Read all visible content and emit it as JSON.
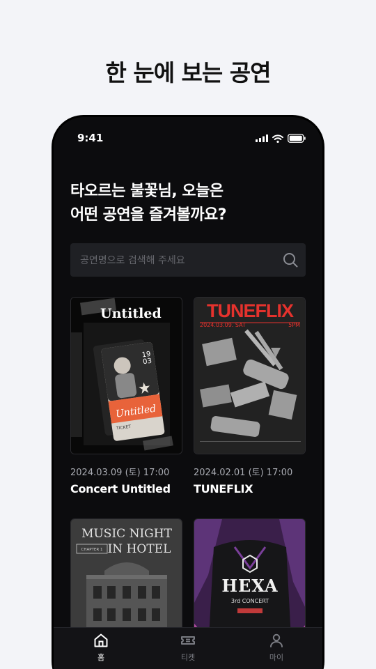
{
  "headline": "한 눈에 보는 공연",
  "status_bar": {
    "time": "9:41"
  },
  "greeting": {
    "line1": "타오르는 불꽃님, 오늘은",
    "line2": "어떤 공연을 즐겨볼까요?"
  },
  "search": {
    "placeholder": "공연명으로 검색해 주세요"
  },
  "cards": [
    {
      "date": "2024.03.09 (토) 17:00",
      "title": "Concert Untitled",
      "poster": {
        "heading": "Untitled",
        "ticket_number_top": "19",
        "ticket_number_mid": "03",
        "ticket_script": "Untitled",
        "ticket_label": "TICKET"
      }
    },
    {
      "date": "2024.02.01 (토) 17:00",
      "title": "TUNEFLIX",
      "poster": {
        "heading": "TUNEFLIX",
        "date_line": "2024.03.09. SAT",
        "time_line": "5PM",
        "accent": "#e5322d"
      }
    },
    {
      "poster": {
        "heading_line1": "MUSIC NIGHT",
        "heading_line2": "IN HOTEL",
        "badge": "CHAPTER 1"
      }
    },
    {
      "poster": {
        "heading": "HEXA",
        "subheading": "3rd CONCERT"
      }
    }
  ],
  "tabbar": [
    {
      "label": "홈",
      "icon": "home-icon",
      "active": true
    },
    {
      "label": "티켓",
      "icon": "ticket-icon",
      "active": false
    },
    {
      "label": "마이",
      "icon": "user-icon",
      "active": false
    }
  ]
}
